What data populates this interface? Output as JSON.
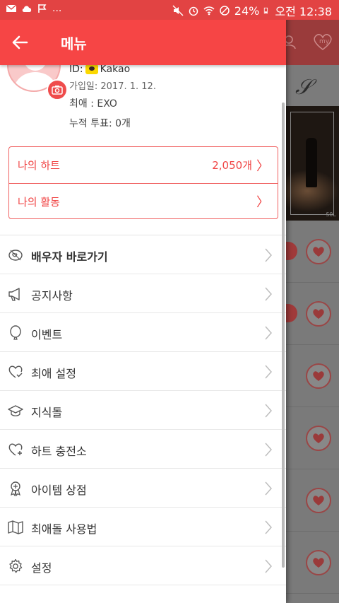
{
  "status_bar": {
    "ellipsis": "...",
    "battery": "24%",
    "time": "오전 12:38"
  },
  "header": {
    "title": "메뉴"
  },
  "background": {
    "header_icons": [
      "user-icon",
      "my-heart-icon"
    ],
    "my_label": "my",
    "photo_tag": "SOL"
  },
  "profile": {
    "id_label": "ID:",
    "login_provider": "Kakao",
    "join_date": "가입일: 2017. 1. 12.",
    "favorite": "최애 : EXO",
    "total_votes": "누적 투표: 0개"
  },
  "summary_box": {
    "my_hearts_label": "나의 하트",
    "my_hearts_value": "2,050개",
    "my_activity_label": "나의 활동",
    "chevron": "〉"
  },
  "menu": {
    "items": [
      {
        "label": "배우자 바로가기",
        "icon": "couple-link-icon",
        "bold": true
      },
      {
        "label": "공지사항",
        "icon": "megaphone-icon",
        "bold": false
      },
      {
        "label": "이벤트",
        "icon": "balloon-icon",
        "bold": false
      },
      {
        "label": "최애 설정",
        "icon": "heart-check-icon",
        "bold": false
      },
      {
        "label": "지식돌",
        "icon": "graduation-cap-icon",
        "bold": false
      },
      {
        "label": "하트 충전소",
        "icon": "heart-plus-icon",
        "bold": false
      },
      {
        "label": "아이템 상점",
        "icon": "medal-icon",
        "bold": false
      },
      {
        "label": "최애돌 사용법",
        "icon": "map-icon",
        "bold": false
      },
      {
        "label": "설정",
        "icon": "gear-icon",
        "bold": false
      }
    ]
  },
  "colors": {
    "accent": "#f64545",
    "status_bar": "#e24343",
    "text": "#333333"
  }
}
